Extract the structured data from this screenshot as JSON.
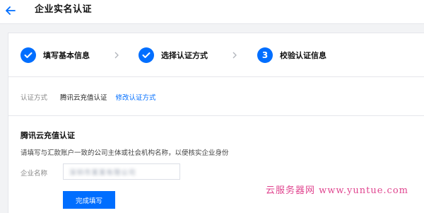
{
  "header": {
    "title": "企业实名认证",
    "back_icon": "arrow-left-icon"
  },
  "colors": {
    "accent": "#006eff",
    "watermark": "#e0458f"
  },
  "steps": [
    {
      "label": "填写基本信息",
      "state": "done",
      "icon": "check-icon"
    },
    {
      "label": "选择认证方式",
      "state": "done",
      "icon": "check-icon"
    },
    {
      "label": "校验认证信息",
      "state": "current",
      "number": "3"
    }
  ],
  "method": {
    "key": "认证方式",
    "value": "腾讯云充值认证",
    "change_link": "修改认证方式"
  },
  "section": {
    "title": "腾讯云充值认证",
    "description": "请填写与汇款账户一致的公司主体或社会机构名称，以便核实企业身份"
  },
  "form": {
    "company_label": "企业名称",
    "company_value": "深圳市某某有限公司",
    "submit_label": "完成填写"
  },
  "watermark": "云服务器网 www.yuntue.com"
}
